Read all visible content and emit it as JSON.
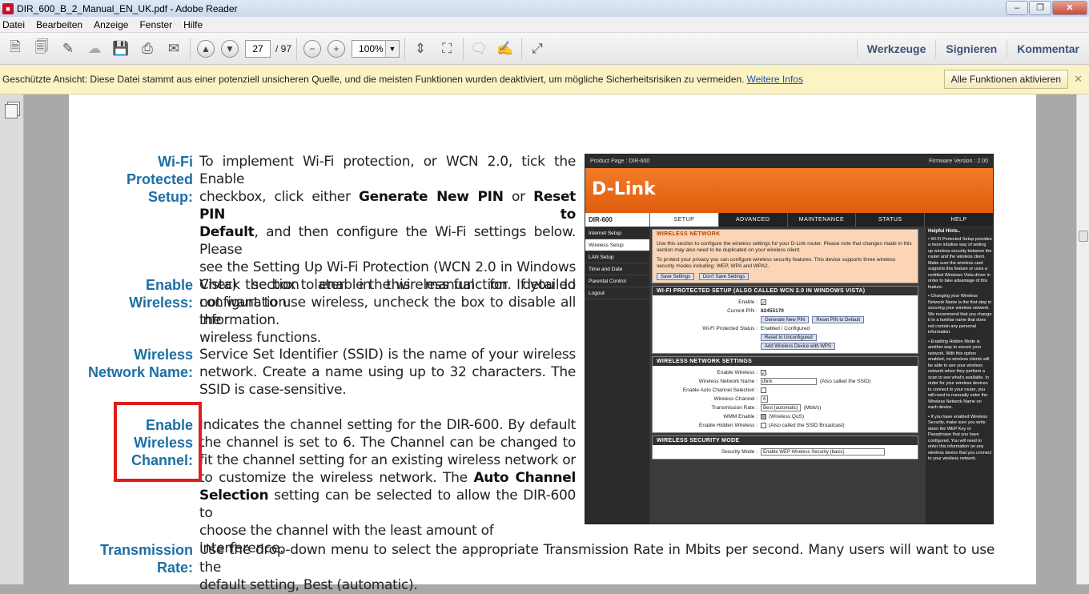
{
  "window": {
    "title": "DIR_600_B_2_Manual_EN_UK.pdf - Adobe Reader",
    "app_icon": "pdf-icon"
  },
  "menu": [
    "Datei",
    "Bearbeiten",
    "Anzeige",
    "Fenster",
    "Hilfe"
  ],
  "toolbar": {
    "page_current": "27",
    "page_total": "/ 97",
    "zoom": "100%",
    "right_buttons": [
      "Werkzeuge",
      "Signieren",
      "Kommentar"
    ]
  },
  "protected_bar": {
    "message": "Geschützte Ansicht: Diese Datei stammt aus einer potenziell unsicheren Quelle, und die meisten Funktionen wurden deaktiviert, um mögliche Sicherheitsrisiken zu vermeiden.",
    "link": "Weitere Infos",
    "button": "Alle Funktionen aktivieren"
  },
  "document": {
    "sections": [
      {
        "term": [
          "Wi-Fi",
          "Protected",
          "Setup:"
        ],
        "lines": [
          "To implement Wi-Fi protection, or WCN 2.0, tick the Enable",
          "checkbox, click either <b>Generate New PIN</b> or <b>Reset PIN to</b>",
          "<b>Default</b>, and then configure the Wi-Fi settings below. Please",
          "see the Setting Up Wi-Fi Protection (WCN 2.0 in Windows",
          "Vista) section later in this manual for detailed configuration",
          "information."
        ]
      },
      {
        "term": [
          "Enable",
          "Wireless:"
        ],
        "lines": [
          "Check the box to enable the wireless function. If you do",
          "not want to use wireless, uncheck the box to disable all the",
          "wireless functions."
        ]
      },
      {
        "term": [
          "Wireless",
          "Network Name:"
        ],
        "lines": [
          "Service Set Identifier (SSID) is the name of your wireless",
          "network. Create a name using up to 32 characters. The",
          "SSID is case-sensitive."
        ]
      },
      {
        "term": [
          "Enable",
          "Wireless",
          "Channel:"
        ],
        "lines": [
          "Indicates the channel setting for the DIR-600. By default",
          "the channel is set to 6. The Channel can be changed to",
          "fit the channel setting for an existing wireless network or",
          "to customize the wireless network. The <b>Auto Channel</b>",
          "<b>Selection</b> setting can be selected to allow the DIR-600 to",
          "choose the channel with the least amount of interference."
        ]
      },
      {
        "term": [
          "Transmission",
          "Rate:"
        ],
        "lines": [
          "Use the drop-down menu to select the appropriate Transmission Rate in Mbits per second. Many users will want to use the",
          "default setting, Best (automatic)."
        ]
      }
    ],
    "highlight_color": "#e21b1b"
  },
  "router_ui": {
    "product_page": "Product Page : DIR-600",
    "firmware": "Firmware Version : 2.00",
    "logo": "D-Link",
    "model": "DIR-600",
    "tabs": [
      "SETUP",
      "ADVANCED",
      "MAINTENANCE",
      "STATUS",
      "HELP"
    ],
    "sidebar": [
      "Internet Setup",
      "Wireless Setup",
      "LAN Setup",
      "Time and Date",
      "Parental Control",
      "Logout"
    ],
    "wireless_network": {
      "title": "WIRELESS NETWORK",
      "text1": "Use this section to configure the wireless settings for your D-Link router. Please note that changes made in this section may also need to be duplicated on your wireless client.",
      "text2": "To protect your privacy you can configure wireless security features. This device supports three wireless security modes including: WEP, WPA and WPA2.",
      "save": "Save Settings",
      "dont_save": "Don't Save Settings"
    },
    "wps": {
      "title": "WI-FI PROTECTED SETUP (ALSO CALLED WCN 2.0 IN WINDOWS VISTA)",
      "enable_label": "Enable :",
      "pin_label": "Current PIN :",
      "pin": "82455170",
      "gen_pin": "Generate New PIN",
      "reset_pin": "Reset PIN to Default",
      "status_label": "Wi-Fi Protected Status :",
      "status": "Enabled / Configured",
      "reset_unconfig": "Reset to Unconfigured",
      "add_device": "Add Wireless Device with WPS"
    },
    "wns": {
      "title": "WIRELESS NETWORK SETTINGS",
      "enable_label": "Enable Wireless :",
      "name_label": "Wireless Network Name :",
      "name": "dlink",
      "name_hint": "(Also called the SSID)",
      "auto_label": "Enable Auto Channel Selection :",
      "channel_label": "Wireless Channel :",
      "channel": "6",
      "rate_label": "Transmission Rate :",
      "rate": "Best (automatic)",
      "rate_unit": "(Mbit/s)",
      "wmm_label": "WMM Enable :",
      "wmm_hint": "(Wireless QoS)",
      "hidden_label": "Enable Hidden Wireless :",
      "hidden_hint": "(Also called the SSID Broadcast)"
    },
    "security": {
      "title": "WIRELESS SECURITY MODE",
      "label": "Security Mode :",
      "value": "Enable WEP Wireless Security (basic)"
    },
    "hints": {
      "title": "Helpful Hints..",
      "items": [
        "• Wi-Fi Protected Setup provides a more intuitive way of setting up wireless security between the router and the wireless client. Make sure the wireless card supports this feature or uses a certified Windows Vista driver in order to take advantage of this feature.",
        "• Changing your Wireless Network Name is the first step in securing your wireless network. We recommend that you change it to a familiar name that does not contain any personal information.",
        "• Enabling Hidden Mode is another way to secure your network. With this option enabled, no wireless clients will be able to see your wireless network when they perform a scan to see what's available. In order for your wireless devices to connect to your router, you will need to manually enter the Wireless Network Name on each device.",
        "• If you have enabled Wireless Security, make sure you write down the WEP Key or Passphrase that you have configured. You will need to enter this information on any wireless device that you connect to your wireless network."
      ]
    }
  }
}
